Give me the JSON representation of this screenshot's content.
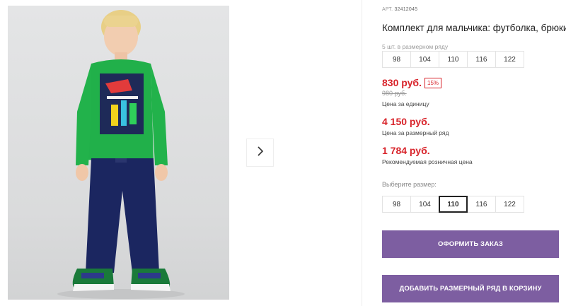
{
  "product": {
    "article_label": "АРТ.",
    "article_number": "32412045",
    "title": "Комплект для мальчика: футболка, брюки"
  },
  "size_row": {
    "caption": "5 шт. в размерном ряду",
    "sizes": [
      "98",
      "104",
      "110",
      "116",
      "122"
    ]
  },
  "pricing": {
    "price": "830 руб.",
    "discount": "15%",
    "old_price": "980 руб.",
    "unit_caption": "Цена за единицу",
    "row_price": "4 150 руб.",
    "row_caption": "Цена за размерный ряд",
    "recommended_price": "1 784 руб.",
    "recommended_caption": "Рекомендуемая розничная цена"
  },
  "size_select": {
    "label": "Выберите размер:",
    "options": [
      "98",
      "104",
      "110",
      "116",
      "122"
    ],
    "selected": "110"
  },
  "actions": {
    "order_label": "ОФОРМИТЬ ЗАКАЗ",
    "add_row_label": "ДОБАВИТЬ РАЗМЕРНЫЙ РЯД В КОРЗИНУ"
  },
  "colors": {
    "accent_purple": "#7d5ea1",
    "price_red": "#d8232a"
  },
  "icons": {
    "next": "chevron-right-icon"
  }
}
